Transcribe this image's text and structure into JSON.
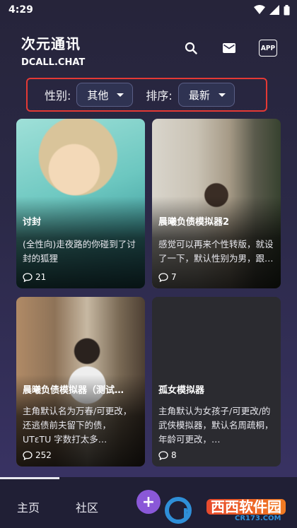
{
  "status": {
    "time": "4:29"
  },
  "header": {
    "title": "次元通讯",
    "domain": "DCALL.CHAT",
    "app_badge": "APP"
  },
  "filters": {
    "gender_label": "性别:",
    "gender_value": "其他",
    "sort_label": "排序:",
    "sort_value": "最新"
  },
  "cards": [
    {
      "title": "讨封",
      "desc": "(全性向)走夜路的你碰到了讨封的狐狸",
      "comments": "21"
    },
    {
      "title": "晨曦负债模拟器2",
      "desc": "感觉可以再来个性转版，就设了一下，默认性别为男，跟前一个一样什么…",
      "comments": "7"
    },
    {
      "title": "晨曦负债模拟器（测试…",
      "desc": "主角默认名为万春/可更改，还逃债前夫留下的债，UTεTU 字数打太多…",
      "comments": "252"
    },
    {
      "title": "孤女模拟器",
      "desc": "主角默认为女孩子/可更改/的武侠模拟器，默认名周疏桐，年龄可更改，…",
      "comments": "8"
    }
  ],
  "nav": {
    "home": "主页",
    "community": "社区",
    "add": "+"
  },
  "watermark": {
    "text": "西西软件园",
    "url": "CR173.COM"
  },
  "colors": {
    "accent": "#8a58d8",
    "highlight_border": "#e53935"
  }
}
